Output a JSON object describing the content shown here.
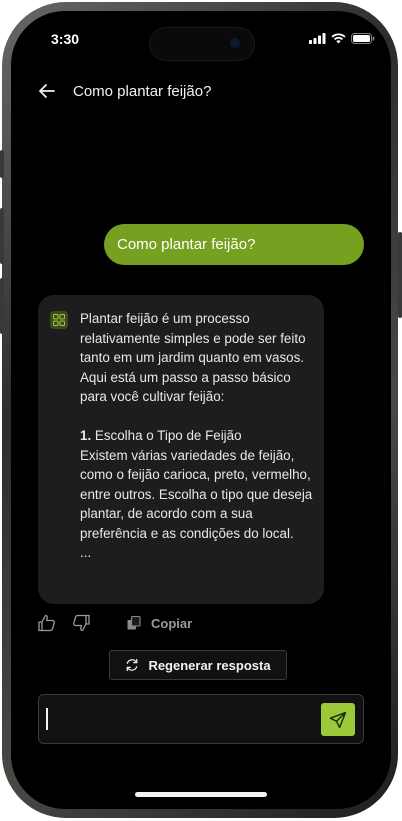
{
  "status_bar": {
    "time": "3:30"
  },
  "header": {
    "title": "Como plantar feijão?"
  },
  "messages": {
    "user": "Como plantar feijão?",
    "assistant": {
      "intro": "Plantar feijão é um processo relativamente simples e pode ser feito tanto em um jardim quanto em vasos. Aqui está um passo a passo básico para você cultivar feijão:",
      "step_number": "1.",
      "step_title": " Escolha o Tipo de Feijão",
      "step_body": "Existem várias variedades de feijão, como o feijão carioca, preto, vermelho, entre outros. Escolha o tipo que deseja plantar, de acordo com a sua preferência e as condições do local.",
      "ellipsis": "..."
    }
  },
  "actions": {
    "copy_label": "Copiar",
    "regenerate_label": "Regenerar resposta"
  },
  "input": {
    "value": "",
    "placeholder": ""
  },
  "colors": {
    "accent": "#76a01f",
    "send_button": "#9bc93a",
    "background": "#000000",
    "bubble": "#1d1d1d"
  },
  "icons": [
    "back-arrow-icon",
    "signal-icon",
    "wifi-icon",
    "battery-icon",
    "assistant-logo-icon",
    "thumbs-up-icon",
    "thumbs-down-icon",
    "copy-icon",
    "refresh-icon",
    "send-icon"
  ]
}
